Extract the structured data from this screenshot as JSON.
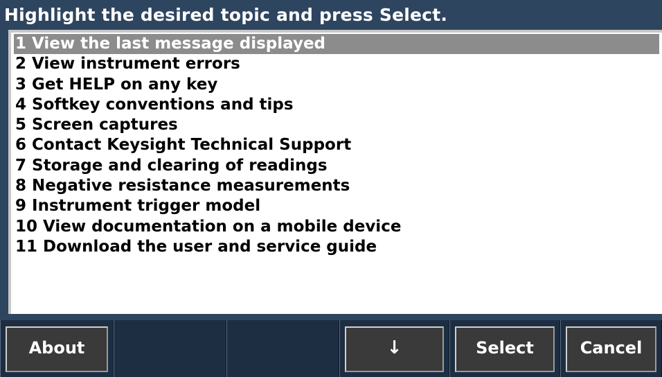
{
  "header": {
    "instruction": "Highlight the desired topic and press Select."
  },
  "topics": [
    {
      "label": "1 View the last message displayed",
      "selected": true
    },
    {
      "label": "2 View instrument errors",
      "selected": false
    },
    {
      "label": "3 Get HELP on any key",
      "selected": false
    },
    {
      "label": "4 Softkey conventions and tips",
      "selected": false
    },
    {
      "label": "5 Screen captures",
      "selected": false
    },
    {
      "label": "6 Contact Keysight Technical Support",
      "selected": false
    },
    {
      "label": "7 Storage and clearing of readings",
      "selected": false
    },
    {
      "label": "8 Negative resistance measurements",
      "selected": false
    },
    {
      "label": "9 Instrument trigger model",
      "selected": false
    },
    {
      "label": "10 View documentation on a mobile device",
      "selected": false
    },
    {
      "label": "11 Download the user and service guide",
      "selected": false
    }
  ],
  "softkeys": {
    "about": "About",
    "down_arrow": "↓",
    "select": "Select",
    "cancel": "Cancel"
  },
  "colors": {
    "background": "#2e4560",
    "selection": "#8c8c8c",
    "softkey_face": "#3a3a3a"
  }
}
